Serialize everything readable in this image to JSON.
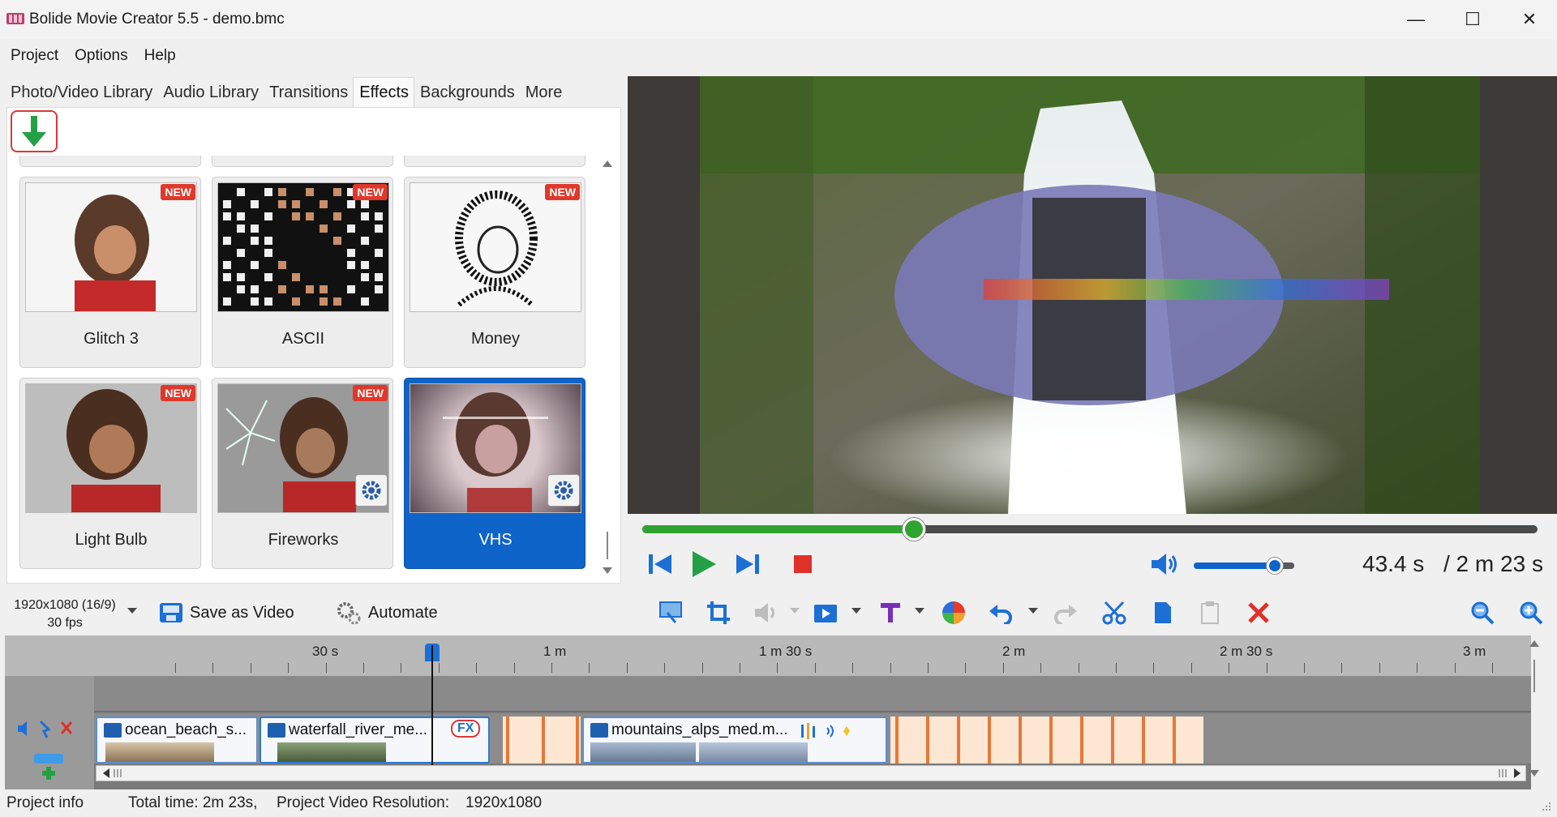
{
  "window": {
    "title": "Bolide Movie Creator 5.5 - demo.bmc",
    "minimize_glyph": "—",
    "maximize_glyph": "☐",
    "close_glyph": "✕"
  },
  "menu": [
    "Project",
    "Options",
    "Help"
  ],
  "library_tabs": [
    {
      "label": "Photo/Video Library",
      "active": false
    },
    {
      "label": "Audio Library",
      "active": false
    },
    {
      "label": "Transitions",
      "active": false
    },
    {
      "label": "Effects",
      "active": true
    },
    {
      "label": "Backgrounds",
      "active": false
    },
    {
      "label": "More",
      "active": false
    }
  ],
  "effects": [
    {
      "name": "Glitch 3",
      "badge": "NEW",
      "settings": false,
      "selected": false
    },
    {
      "name": "ASCII",
      "badge": "NEW",
      "settings": false,
      "selected": false
    },
    {
      "name": "Money",
      "badge": "NEW",
      "settings": false,
      "selected": false
    },
    {
      "name": "Light Bulb",
      "badge": "NEW",
      "settings": false,
      "selected": false
    },
    {
      "name": "Fireworks",
      "badge": "NEW",
      "settings": true,
      "selected": false
    },
    {
      "name": "VHS",
      "badge": "",
      "settings": true,
      "selected": true
    }
  ],
  "player": {
    "progress": 0.303,
    "volume": 0.72,
    "time_current": "43.4 s",
    "time_total": "/ 2 m 23 s"
  },
  "toolbar": {
    "resolution": "1920x1080 (16/9)",
    "fps": "30 fps",
    "save_label": "Save as Video",
    "automate_label": "Automate"
  },
  "timeline": {
    "ruler_labels": [
      "30 s",
      "1 m",
      "1 m 30 s",
      "2 m",
      "2 m 30 s",
      "3 m"
    ],
    "clips": [
      {
        "name": "ocean_beach_s..."
      },
      {
        "name": "waterfall_river_me...",
        "fx": "FX"
      },
      {
        "name": "mountains_alps_med.m..."
      }
    ]
  },
  "status": {
    "project_info": "Project info",
    "total_time": "Total time: 2m 23s,",
    "resolution_label": "Project Video Resolution:",
    "resolution_value": "1920x1080"
  },
  "colors": {
    "accent": "#0e64c8",
    "play_green": "#2fa32f",
    "stop_red": "#e0302a",
    "badge_red": "#e0382a",
    "transition_orange": "#e5783a"
  }
}
